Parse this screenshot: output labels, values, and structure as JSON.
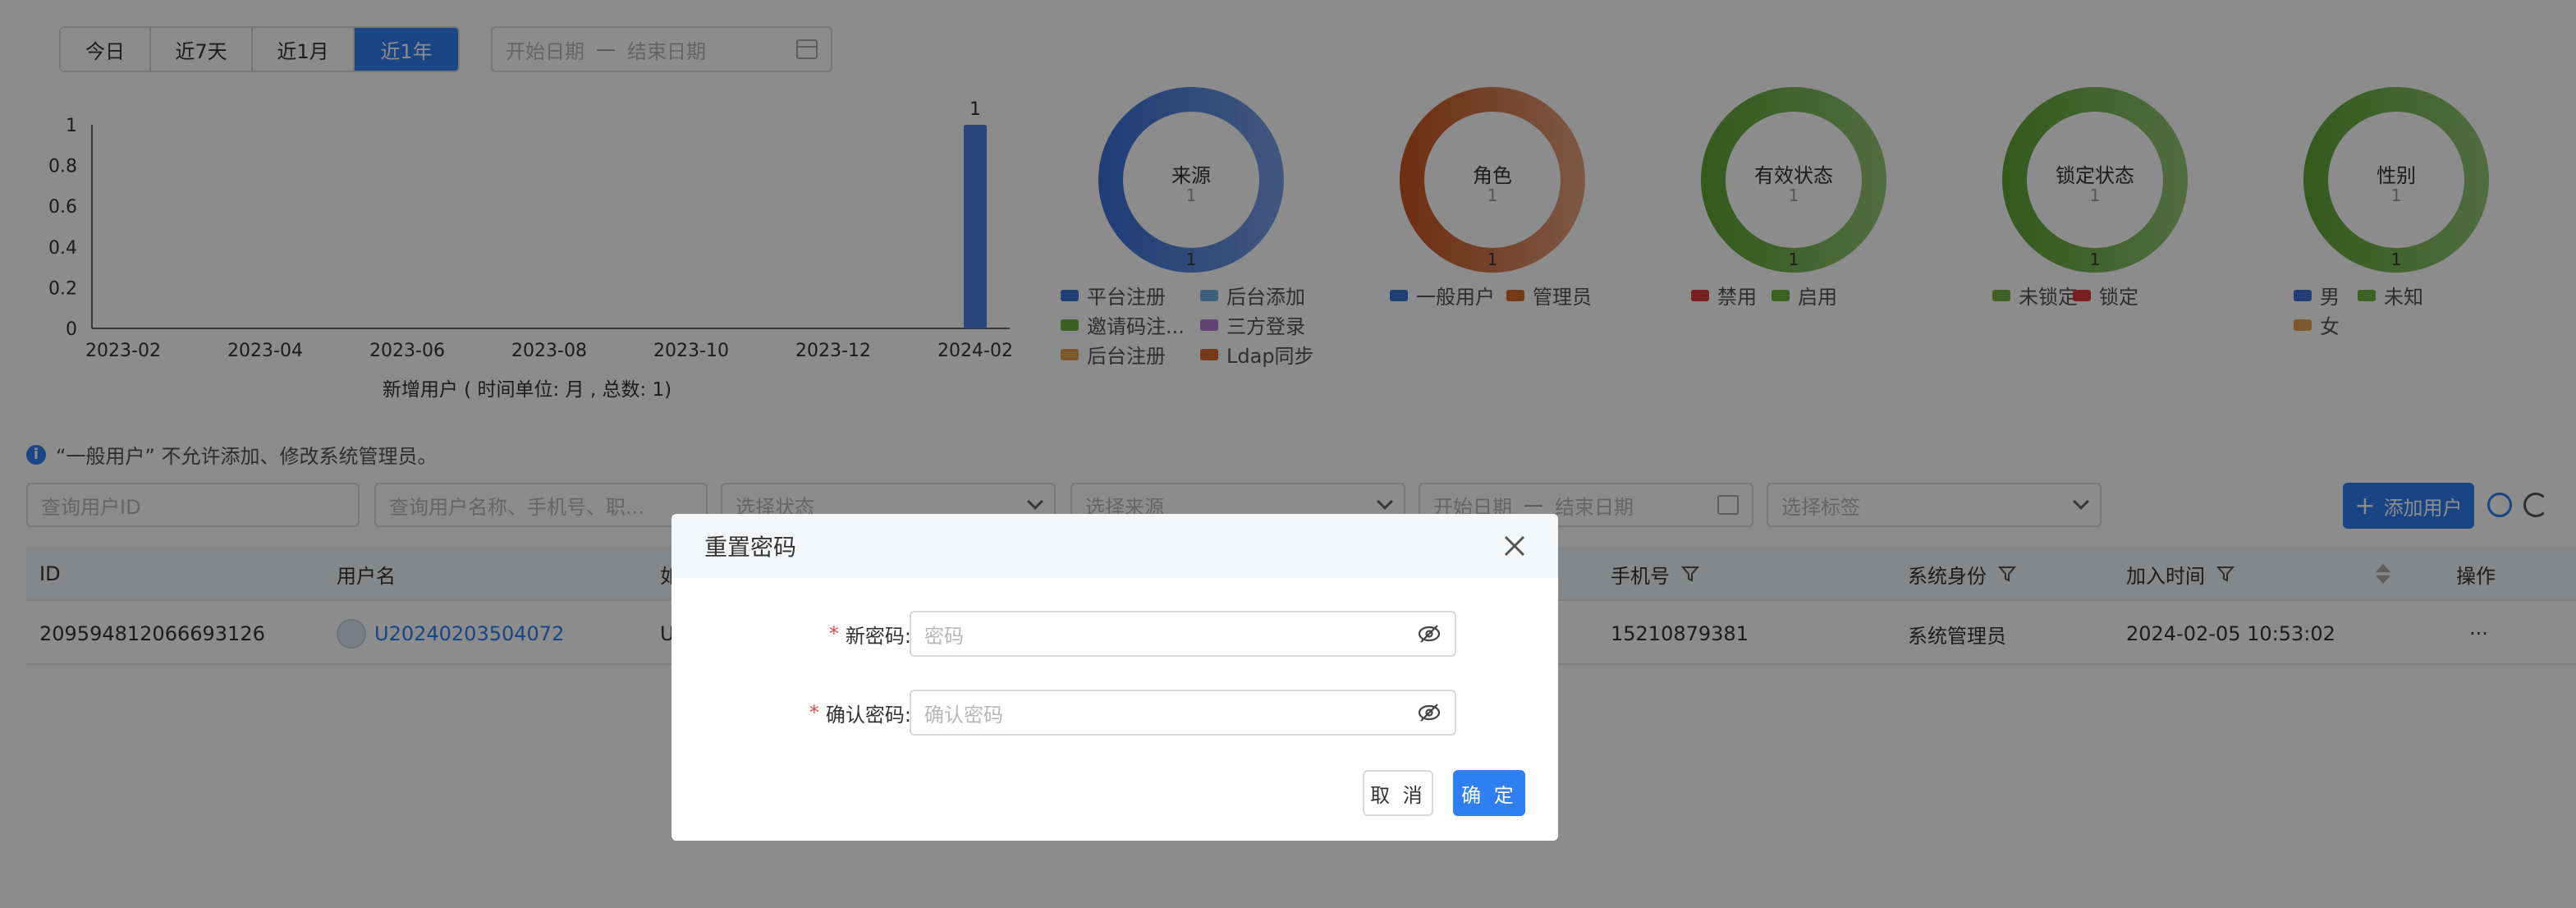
{
  "range_tabs": [
    "今日",
    "近7天",
    "近1月",
    "近1年"
  ],
  "active_range_index": 3,
  "top_date_range": {
    "start_placeholder": "开始日期",
    "separator": "—",
    "end_placeholder": "结束日期"
  },
  "colors": {
    "primary": "#2f7ff0",
    "mask": "rgba(0,0,0,0.45)",
    "required": "#e04b4b"
  },
  "chart_data": {
    "type": "bar",
    "categories": [
      "2023-02",
      "2023-04",
      "2023-06",
      "2023-08",
      "2023-10",
      "2023-12",
      "2024-02"
    ],
    "x_tick_labels": [
      "2023-02",
      "2023-04",
      "2023-06",
      "2023-08",
      "2023-10",
      "2023-12",
      "2024-02"
    ],
    "values": [
      0,
      0,
      0,
      0,
      0,
      0,
      1
    ],
    "data_labels": [
      "",
      "",
      "",
      "",
      "",
      "",
      "1"
    ],
    "y_ticks": [
      "0",
      "0.2",
      "0.4",
      "0.6",
      "0.8",
      "1"
    ],
    "ylim": [
      0,
      1
    ],
    "xlabel": "新增用户 ( 时间单位: 月 , 总数: 1)",
    "grid": false,
    "bar_color": "#4a7fe0"
  },
  "donuts": [
    {
      "title": "来源",
      "count": "1",
      "bottom_label": "1",
      "color_from": "#3a6fd8",
      "color_to": "#7aa0e6",
      "legend": [
        {
          "label": "平台注册",
          "color": "#3e74d9"
        },
        {
          "label": "后台添加",
          "color": "#6cb3de"
        },
        {
          "label": "邀请码注...",
          "color": "#6db13f"
        },
        {
          "label": "三方登录",
          "color": "#b07ad6"
        },
        {
          "label": "后台注册",
          "color": "#e0a054"
        },
        {
          "label": "Ldap同步",
          "color": "#d86b2c"
        }
      ]
    },
    {
      "title": "角色",
      "count": "1",
      "bottom_label": "1",
      "color_from": "#c8541f",
      "color_to": "#e2a27f",
      "legend": [
        {
          "label": "一般用户",
          "color": "#3e74d9"
        },
        {
          "label": "管理员",
          "color": "#d86b2c"
        }
      ]
    },
    {
      "title": "有效状态",
      "count": "1",
      "bottom_label": "1",
      "color_from": "#5ea434",
      "color_to": "#94c777",
      "legend": [
        {
          "label": "禁用",
          "color": "#d83b3b"
        },
        {
          "label": "启用",
          "color": "#6db13f"
        }
      ]
    },
    {
      "title": "锁定状态",
      "count": "1",
      "bottom_label": "1",
      "color_from": "#5ea434",
      "color_to": "#94c777",
      "legend": [
        {
          "label": "未锁定",
          "color": "#6db13f"
        },
        {
          "label": "锁定",
          "color": "#d83b3b"
        }
      ]
    },
    {
      "title": "性别",
      "count": "1",
      "bottom_label": "1",
      "color_from": "#5ea434",
      "color_to": "#94c777",
      "legend": [
        {
          "label": "男",
          "color": "#3e74d9"
        },
        {
          "label": "未知",
          "color": "#6db13f"
        },
        {
          "label": "女",
          "color": "#e0a054"
        }
      ]
    }
  ],
  "notice": "“一般用户” 不允许添加、修改系统管理员。",
  "filters": {
    "user_id_placeholder": "查询用户ID",
    "user_query_placeholder": "查询用户名称、手机号、职...",
    "status_placeholder": "选择状态",
    "source_placeholder": "选择来源",
    "start_date_placeholder": "开始日期",
    "separator": "—",
    "end_date_placeholder": "结束日期",
    "tag_placeholder": "选择标签"
  },
  "add_user_button": "添加用户",
  "table": {
    "headers": {
      "id": "ID",
      "username": "用户名",
      "hidden_col": "如",
      "phone": "手机号",
      "system_role": "系统身份",
      "join_time": "加入时间",
      "actions": "操作"
    },
    "rows": [
      {
        "id": "209594812066693126",
        "username": "U20240203504072",
        "hidden_col": "U",
        "phone": "15210879381",
        "system_role": "系统管理员",
        "join_time": "2024-02-05 10:53:02",
        "actions": "···"
      }
    ]
  },
  "modal": {
    "title": "重置密码",
    "required_mark": "*",
    "new_password_label": "新密码:",
    "new_password_placeholder": "密码",
    "confirm_password_label": "确认密码:",
    "confirm_password_placeholder": "确认密码",
    "cancel_label": "取 消",
    "ok_label": "确 定"
  }
}
